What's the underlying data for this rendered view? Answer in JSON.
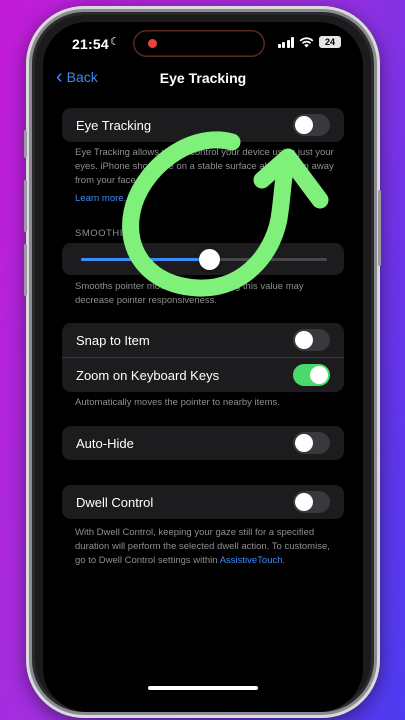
{
  "status_bar": {
    "time": "21:54",
    "battery": "24"
  },
  "nav": {
    "back_label": "Back",
    "title": "Eye Tracking"
  },
  "eye_tracking": {
    "label": "Eye Tracking",
    "enabled": false,
    "description": "Eye Tracking allows you to control your device using just your eyes. iPhone should be on a stable surface about 30cm away from your face.",
    "learn_more": "Learn more..."
  },
  "smoothing": {
    "header": "SMOOTHING",
    "value_fraction": 0.52,
    "description": "Smooths pointer movement. Increasing this value may decrease pointer responsiveness."
  },
  "pointer_group": {
    "items": [
      {
        "label": "Snap to Item",
        "enabled": false
      },
      {
        "label": "Zoom on Keyboard Keys",
        "enabled": true
      }
    ],
    "description": "Automatically moves the pointer to nearby items."
  },
  "auto_hide": {
    "label": "Auto-Hide",
    "enabled": false
  },
  "dwell": {
    "label": "Dwell Control",
    "enabled": false,
    "description": "With Dwell Control, keeping your gaze still for a specified duration will perform the selected dwell action. To customise, go to Dwell Control settings within",
    "link": "AssistiveTouch."
  },
  "colors": {
    "accent": "#3b8cf6",
    "toggle_on": "#4cd96c",
    "annotation": "#7ff07a"
  }
}
